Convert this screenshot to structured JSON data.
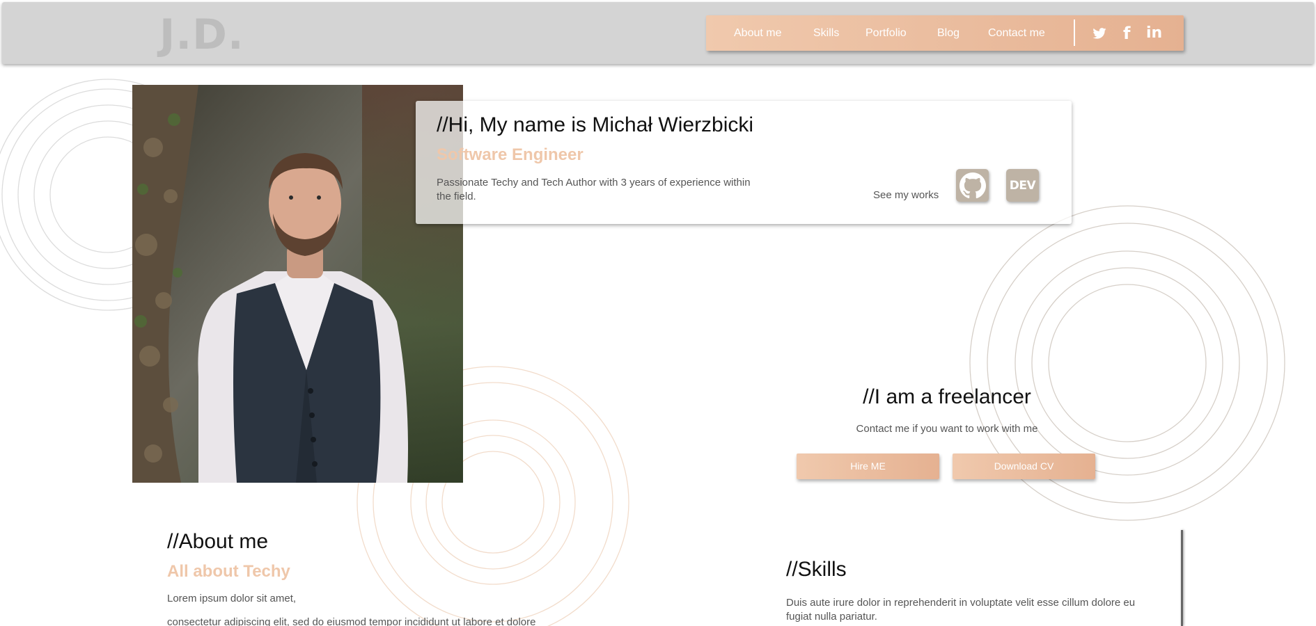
{
  "header": {
    "logo": "J.D.",
    "nav": [
      "About me",
      "Skills",
      "Portfolio",
      "Blog",
      "Contact me"
    ],
    "social_icons": [
      "twitter-icon",
      "facebook-icon",
      "linkedin-icon"
    ],
    "social_glyphs": {
      "facebook": "f",
      "linkedin": "in"
    }
  },
  "intro": {
    "title": "//Hi, My name is Michał Wierzbicki",
    "subtitle": "Software Engineer",
    "description": "Passionate Techy and Tech Author with 3 years of experience within the field.",
    "see_works": "See my works",
    "works_icons": [
      "github-icon",
      "dev-icon"
    ],
    "dev_label": "DEV"
  },
  "freelance": {
    "title": "//I am a freelancer",
    "description": "Contact me if you want to work with me",
    "hire_label": "Hire ME",
    "download_label": "Download CV"
  },
  "about": {
    "title": "//About me",
    "subtitle": "All about Techy",
    "paragraph_1": "Lorem ipsum dolor sit amet,",
    "paragraph_2": "consectetur adipiscing elit, sed do eiusmod tempor incididunt ut labore et dolore"
  },
  "skills": {
    "title": "//Skills",
    "description": "Duis aute irure dolor in reprehenderit in voluptate velit esse cillum dolore eu fugiat nulla pariatur."
  },
  "colors": {
    "header_bg": "#d4d4d4",
    "accent": "#efc7aa",
    "accent_dark": "#e5b191",
    "icon_tile": "#beb3a5"
  }
}
